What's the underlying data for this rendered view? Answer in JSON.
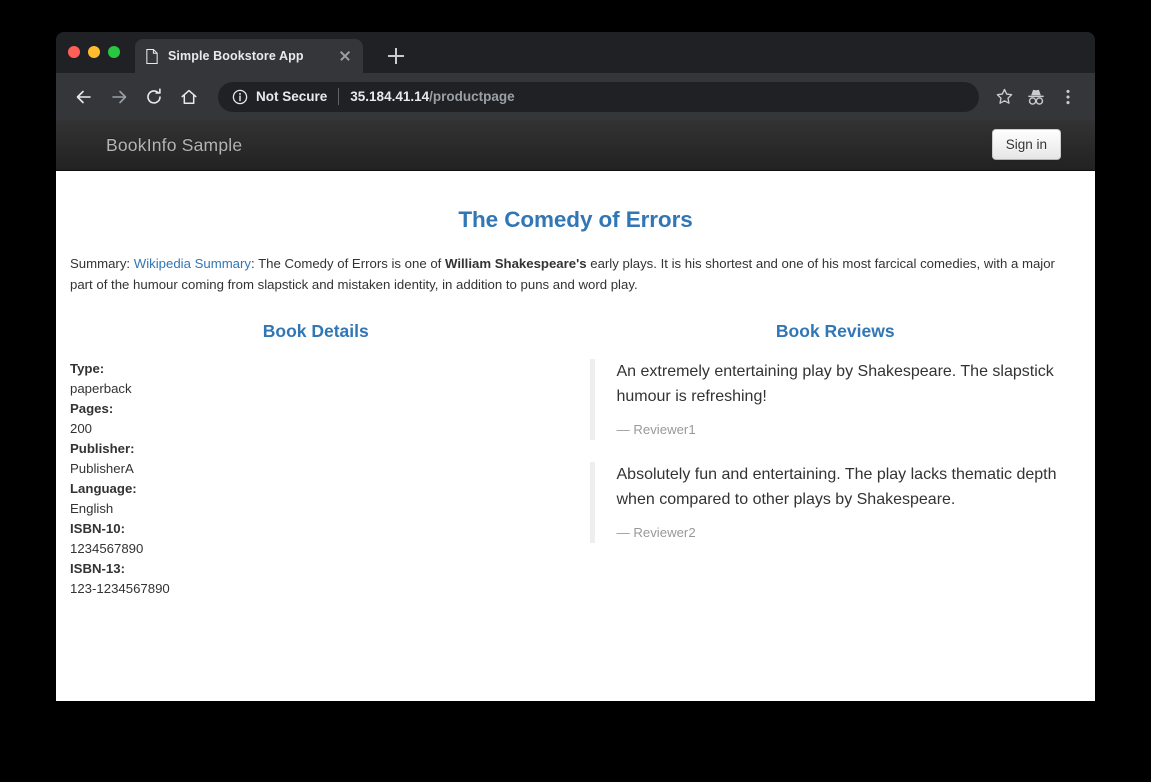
{
  "browser": {
    "tab": {
      "title": "Simple Bookstore App",
      "favicon_icon": "page-document-icon",
      "close_icon": "close-icon"
    },
    "new_tab_icon": "plus-icon",
    "nav": {
      "back_icon": "arrow-left-icon",
      "forward_icon": "arrow-right-icon",
      "reload_icon": "reload-icon",
      "home_icon": "home-icon"
    },
    "omnibox": {
      "info_icon": "info-circle-icon",
      "security_label": "Not Secure",
      "url_host": "35.184.41.14",
      "url_path": "/productpage"
    },
    "actions": {
      "bookmark_icon": "star-icon",
      "incognito_icon": "incognito-icon",
      "menu_icon": "three-dot-menu-icon"
    },
    "traffic_lights": {
      "close_color": "#ff5f57",
      "minimize_color": "#febc2e",
      "maximize_color": "#28c840"
    }
  },
  "app": {
    "brand": "BookInfo Sample",
    "signin_label": "Sign in",
    "accent_color": "#3176b5",
    "navbar_color": "#222222"
  },
  "product": {
    "title": "The Comedy of Errors",
    "summary": {
      "prefix": "Summary: ",
      "link_text": "Wikipedia Summary",
      "part1": ": The Comedy of Errors is one of ",
      "author": "William Shakespeare's",
      "part2": " early plays. It is his shortest and one of his most farcical comedies, with a major part of the humour coming from slapstick and mistaken identity, in addition to puns and word play."
    }
  },
  "details": {
    "heading": "Book Details",
    "items": [
      {
        "label": "Type:",
        "value": "paperback"
      },
      {
        "label": "Pages:",
        "value": "200"
      },
      {
        "label": "Publisher:",
        "value": "PublisherA"
      },
      {
        "label": "Language:",
        "value": "English"
      },
      {
        "label": "ISBN-10:",
        "value": "1234567890"
      },
      {
        "label": "ISBN-13:",
        "value": "123-1234567890"
      }
    ]
  },
  "reviews": {
    "heading": "Book Reviews",
    "items": [
      {
        "text": "An extremely entertaining play by Shakespeare. The slapstick humour is refreshing!",
        "reviewer": "— Reviewer1"
      },
      {
        "text": "Absolutely fun and entertaining. The play lacks thematic depth when compared to other plays by Shakespeare.",
        "reviewer": "— Reviewer2"
      }
    ]
  }
}
